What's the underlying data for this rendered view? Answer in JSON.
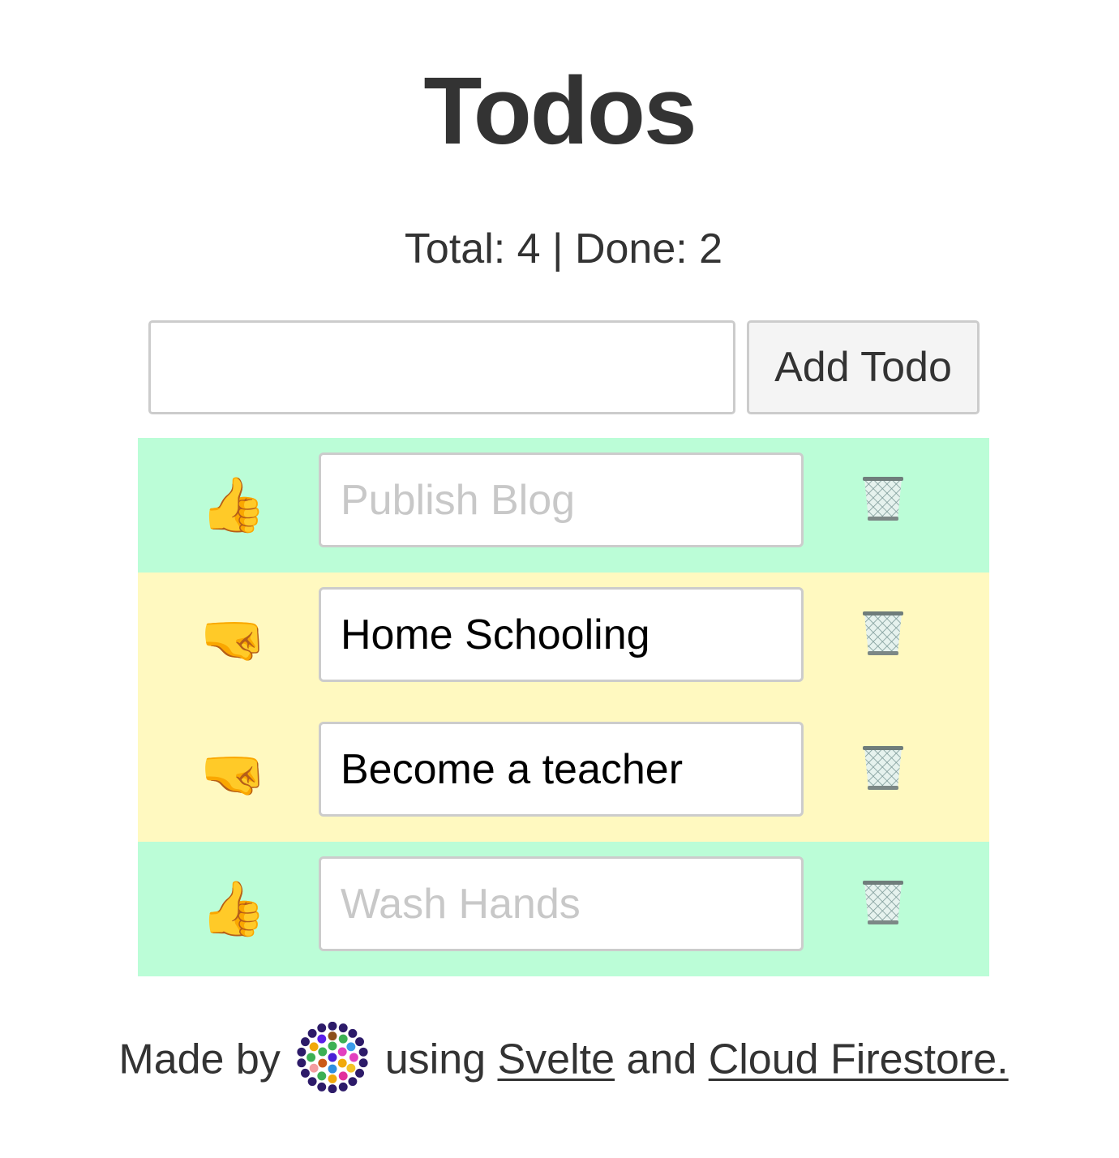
{
  "header": {
    "title": "Todos",
    "stats_text": "Total: 4 | Done: 2",
    "total": 4,
    "done": 2
  },
  "new_todo": {
    "value": "",
    "placeholder": "",
    "add_button_label": "Add Todo"
  },
  "colors": {
    "done_row": "#bbfdd7",
    "pending_row": "#fff9c0",
    "text": "#333333",
    "done_text": "#c8c8c8"
  },
  "todos": [
    {
      "text": "Publish Blog",
      "done": true,
      "status_icon": "thumbs-up-icon",
      "status_glyph": "👍",
      "delete_icon": "wastebasket-icon"
    },
    {
      "text": "Home Schooling",
      "done": false,
      "status_icon": "fist-icon",
      "status_glyph": "🤜",
      "delete_icon": "wastebasket-icon"
    },
    {
      "text": "Become a teacher",
      "done": false,
      "status_icon": "fist-icon",
      "status_glyph": "🤜",
      "delete_icon": "wastebasket-icon"
    },
    {
      "text": "Wash Hands",
      "done": true,
      "status_icon": "thumbs-up-icon",
      "status_glyph": "👍",
      "delete_icon": "wastebasket-icon"
    }
  ],
  "footer": {
    "made_by": "Made by",
    "using": "using",
    "svelte_link": "Svelte",
    "and": "and",
    "firestore_link": "Cloud Firestore."
  }
}
